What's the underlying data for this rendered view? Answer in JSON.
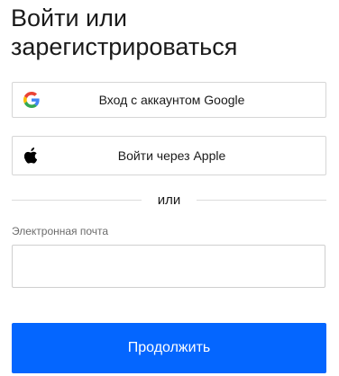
{
  "heading": {
    "title": "Войти или зарегистрироваться"
  },
  "social": {
    "google": {
      "label": "Вход с аккаунтом Google",
      "icon": "google-icon"
    },
    "apple": {
      "label": "Войти через Apple",
      "icon": "apple-icon"
    }
  },
  "divider": {
    "text": "или"
  },
  "email": {
    "label": "Электронная почта",
    "value": "",
    "placeholder": ""
  },
  "continue": {
    "label": "Продолжить"
  },
  "colors": {
    "primary": "#0466ff",
    "border": "#d6d6d6",
    "text": "#1a1a1a",
    "muted": "#6b6b6b"
  }
}
